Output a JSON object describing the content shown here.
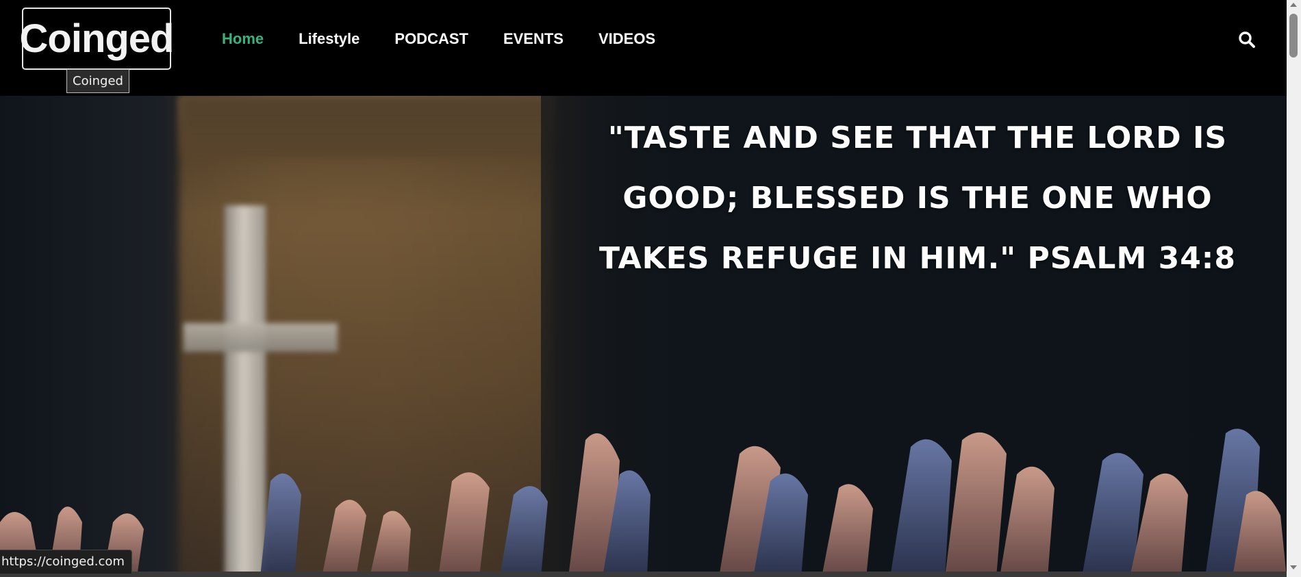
{
  "header": {
    "logo_text": "Coinged",
    "logo_tooltip": "Coinged",
    "nav": [
      {
        "label": "Home",
        "active": true
      },
      {
        "label": "Lifestyle",
        "active": false
      },
      {
        "label": "PODCAST",
        "active": false
      },
      {
        "label": "EVENTS",
        "active": false
      },
      {
        "label": "VIDEOS",
        "active": false
      }
    ],
    "search_icon": "search-icon"
  },
  "hero": {
    "quote": "\"TASTE AND SEE THAT THE LORD IS GOOD; BLESSED IS THE ONE WHO TAKES REFUGE IN HIM.\" PSALM 34:8"
  },
  "status_bar": {
    "url": "https://coinged.com"
  },
  "colors": {
    "active_nav": "#36b37e",
    "header_bg": "#000000",
    "text": "#ffffff"
  }
}
